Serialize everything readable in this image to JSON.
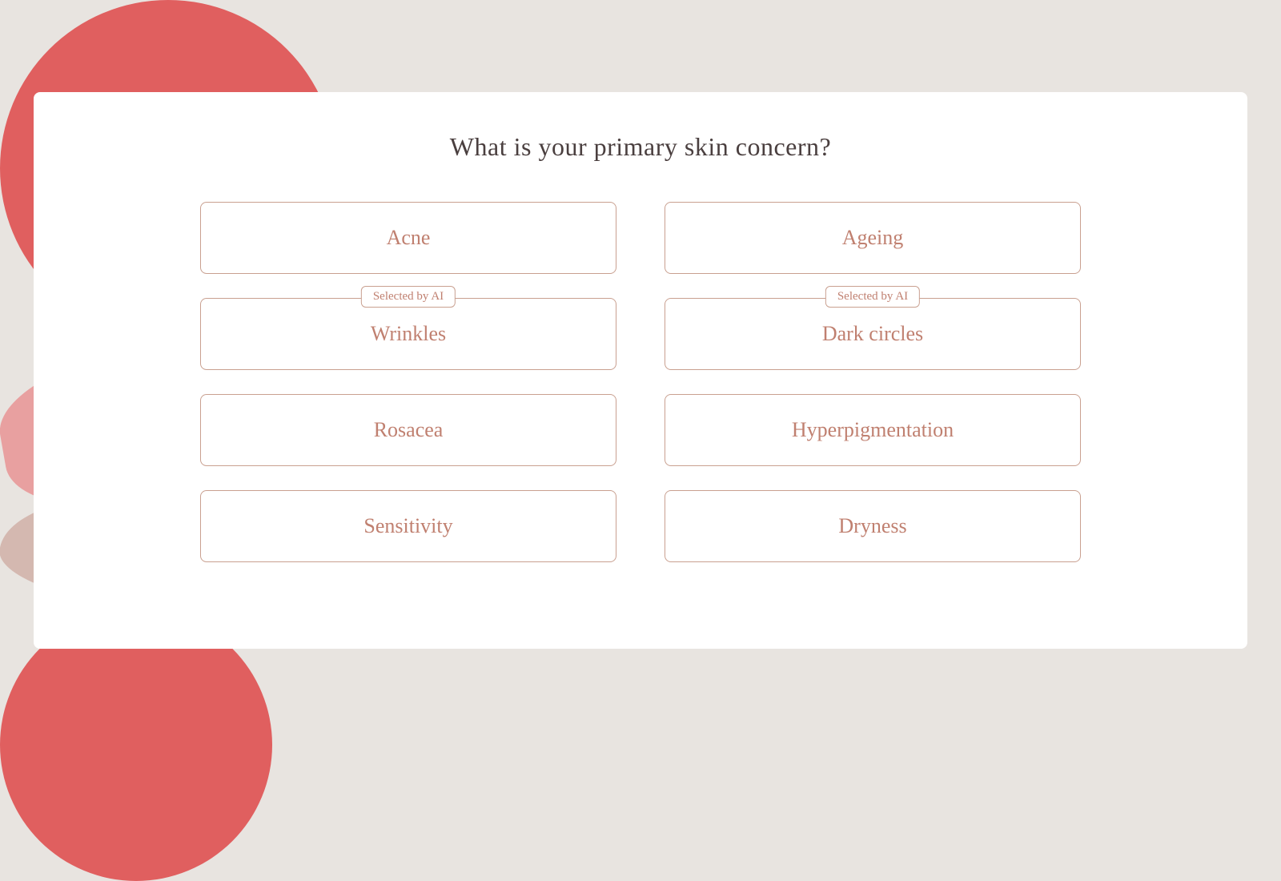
{
  "background": {
    "color": "#e8e4e0",
    "accent_red": "#e05f5f",
    "accent_pink": "#e8a0a0",
    "accent_muted": "#d4b8b0"
  },
  "card": {
    "title": "What is your primary skin concern?"
  },
  "options": [
    {
      "id": "acne",
      "label": "Acne",
      "ai_selected": false,
      "ai_label": ""
    },
    {
      "id": "ageing",
      "label": "Ageing",
      "ai_selected": false,
      "ai_label": ""
    },
    {
      "id": "wrinkles",
      "label": "Wrinkles",
      "ai_selected": true,
      "ai_label": "Selected by AI"
    },
    {
      "id": "dark-circles",
      "label": "Dark circles",
      "ai_selected": true,
      "ai_label": "Selected by AI"
    },
    {
      "id": "rosacea",
      "label": "Rosacea",
      "ai_selected": false,
      "ai_label": ""
    },
    {
      "id": "hyperpigmentation",
      "label": "Hyperpigmentation",
      "ai_selected": false,
      "ai_label": ""
    },
    {
      "id": "sensitivity",
      "label": "Sensitivity",
      "ai_selected": false,
      "ai_label": ""
    },
    {
      "id": "dryness",
      "label": "Dryness",
      "ai_selected": false,
      "ai_label": ""
    }
  ]
}
